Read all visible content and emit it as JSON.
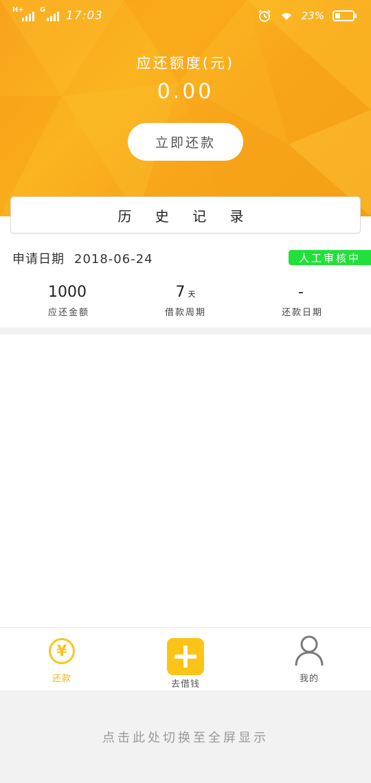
{
  "status_bar": {
    "network_1": "H+",
    "network_2": "G",
    "time": "17:03",
    "battery": "23%",
    "icons": [
      "signal-icon",
      "alarm-icon",
      "wifi-icon",
      "battery-icon"
    ]
  },
  "header": {
    "credit_label": "应还额度(元)",
    "credit_amount": "0.00",
    "repay_button": "立即还款"
  },
  "history": {
    "title": "历 史 记 录"
  },
  "record": {
    "date_label": "申请日期",
    "date_value": "2018-06-24",
    "status": "人工审核中",
    "stats": [
      {
        "value": "1000",
        "unit": "",
        "label": "应还金额"
      },
      {
        "value": "7",
        "unit": "天",
        "label": "借款周期"
      },
      {
        "value": "-",
        "unit": "",
        "label": "还款日期"
      }
    ]
  },
  "bottom_nav": {
    "items": [
      {
        "label": "还款",
        "icon": "yen-circle-icon",
        "active": true
      },
      {
        "label": "去借钱",
        "icon": "plus-square-icon",
        "active": false
      },
      {
        "label": "我的",
        "icon": "person-icon",
        "active": false
      }
    ]
  },
  "fullscreen_hint": "点击此处切换至全屏显示",
  "colors": {
    "header_orange": "#f7a21a",
    "status_green": "#22e03a",
    "accent_yellow": "#fbc416"
  }
}
